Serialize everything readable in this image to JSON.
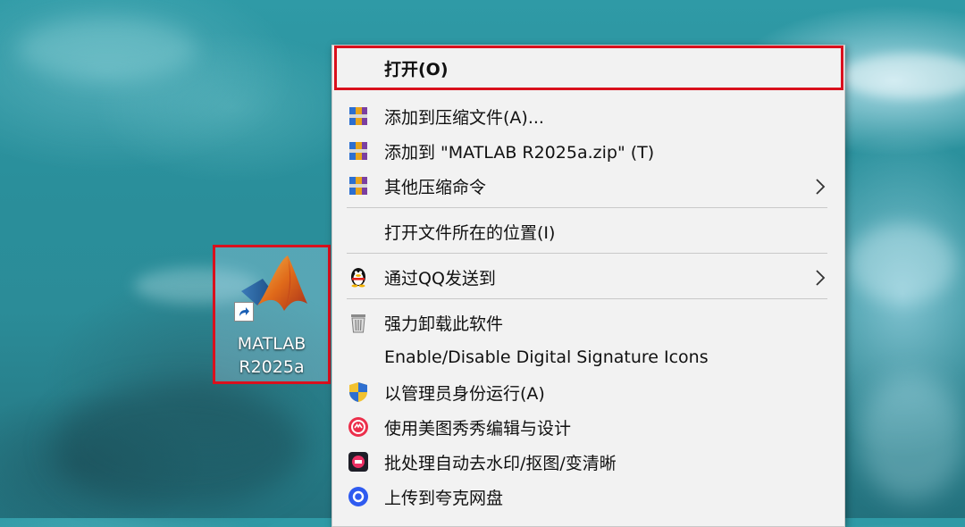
{
  "desktop_icon": {
    "label_line1": "MATLAB",
    "label_line2": "R2025a"
  },
  "context_menu": {
    "items": [
      {
        "label": "打开(O)",
        "icon": null
      },
      {
        "label": "添加到压缩文件(A)...",
        "icon": "winrar-archive-icon"
      },
      {
        "label": "添加到 \"MATLAB R2025a.zip\" (T)",
        "icon": "winrar-archive-icon"
      },
      {
        "label": "其他压缩命令",
        "icon": "winrar-archive-icon",
        "submenu": true
      },
      {
        "label": "打开文件所在的位置(I)",
        "icon": null
      },
      {
        "label": "通过QQ发送到",
        "icon": "qq-penguin-icon",
        "submenu": true
      },
      {
        "label": "强力卸载此软件",
        "icon": "trash-bin-icon"
      },
      {
        "label": "Enable/Disable Digital Signature Icons",
        "icon": null
      },
      {
        "label": "以管理员身份运行(A)",
        "icon": "uac-shield-icon"
      },
      {
        "label": "使用美图秀秀编辑与设计",
        "icon": "meitu-icon"
      },
      {
        "label": "批处理自动去水印/抠图/变清晰",
        "icon": "batch-process-icon"
      },
      {
        "label": "上传到夸克网盘",
        "icon": "quark-drive-icon"
      }
    ]
  },
  "colors": {
    "highlight_border": "#d9101d",
    "menu_background": "#f2f2f2"
  }
}
